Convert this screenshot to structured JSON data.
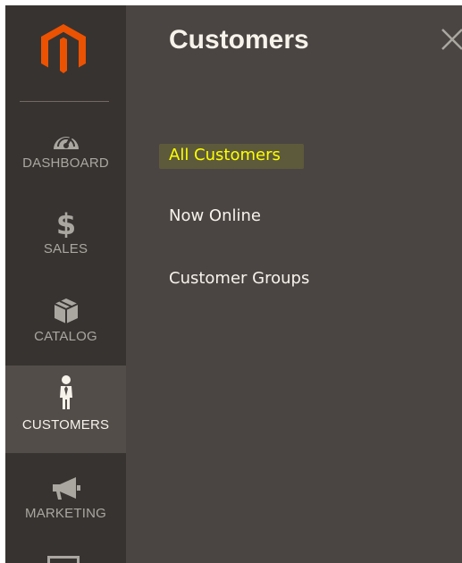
{
  "sidebar": {
    "logo_icon": "magento-logo-icon",
    "brand_color": "#eb5202",
    "items": [
      {
        "label": "DASHBOARD",
        "icon": "dashboard-gauge-icon",
        "active": false
      },
      {
        "label": "SALES",
        "icon": "dollar-icon",
        "active": false
      },
      {
        "label": "CATALOG",
        "icon": "box-icon",
        "active": false
      },
      {
        "label": "CUSTOMERS",
        "icon": "person-icon",
        "active": true
      },
      {
        "label": "MARKETING",
        "icon": "megaphone-icon",
        "active": false
      }
    ]
  },
  "panel": {
    "title": "Customers",
    "close_icon": "close-icon",
    "links": [
      {
        "label": "All Customers",
        "highlighted": true
      },
      {
        "label": "Now Online",
        "highlighted": false
      },
      {
        "label": "Customer Groups",
        "highlighted": false
      }
    ]
  },
  "colors": {
    "sidebar_bg": "#373330",
    "panel_bg": "#4a4542",
    "active_item_bg": "#524d49",
    "highlight_text": "#ffff00"
  }
}
